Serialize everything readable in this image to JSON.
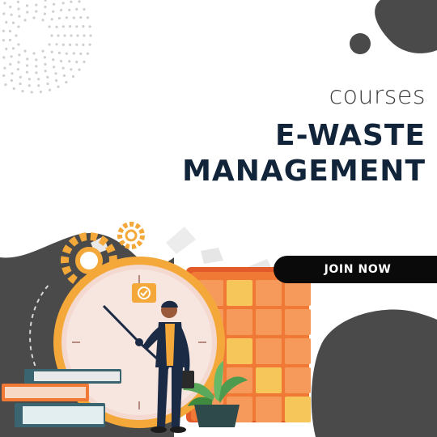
{
  "header": {
    "kicker": "courses",
    "title_line1": "E-WASTE",
    "title_line2": "MANAGEMENT"
  },
  "cta": {
    "label": "JOIN NOW"
  },
  "colors": {
    "dark_blob": "#4a4a4a",
    "title": "#12243a",
    "button": "#0a0a0a",
    "orange": "#f07a35",
    "gold": "#f4a83a"
  },
  "icons": [
    "dot-pattern-decoration",
    "gear-icon",
    "clock-illustration",
    "calendar-illustration",
    "books-illustration",
    "plant-illustration",
    "businessman-illustration"
  ]
}
